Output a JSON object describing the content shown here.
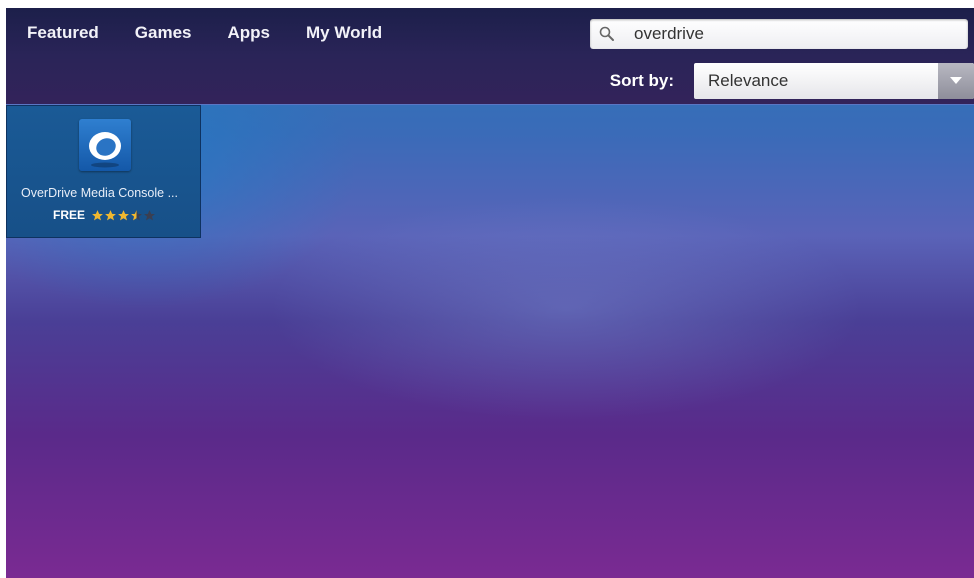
{
  "nav": {
    "items": [
      {
        "label": "Featured"
      },
      {
        "label": "Games"
      },
      {
        "label": "Apps"
      },
      {
        "label": "My World"
      }
    ]
  },
  "search": {
    "value": "overdrive",
    "icon": "search-icon"
  },
  "sort": {
    "label": "Sort by:",
    "selected": "Relevance",
    "icon": "chevron-down-icon"
  },
  "results": [
    {
      "name": "OverDrive Media Console ...",
      "price": "FREE",
      "rating": 3.5,
      "rating_max": 5,
      "icon": "overdrive-app-icon"
    }
  ],
  "colors": {
    "star_filled": "#f0b830",
    "star_empty": "#3a3f52"
  }
}
